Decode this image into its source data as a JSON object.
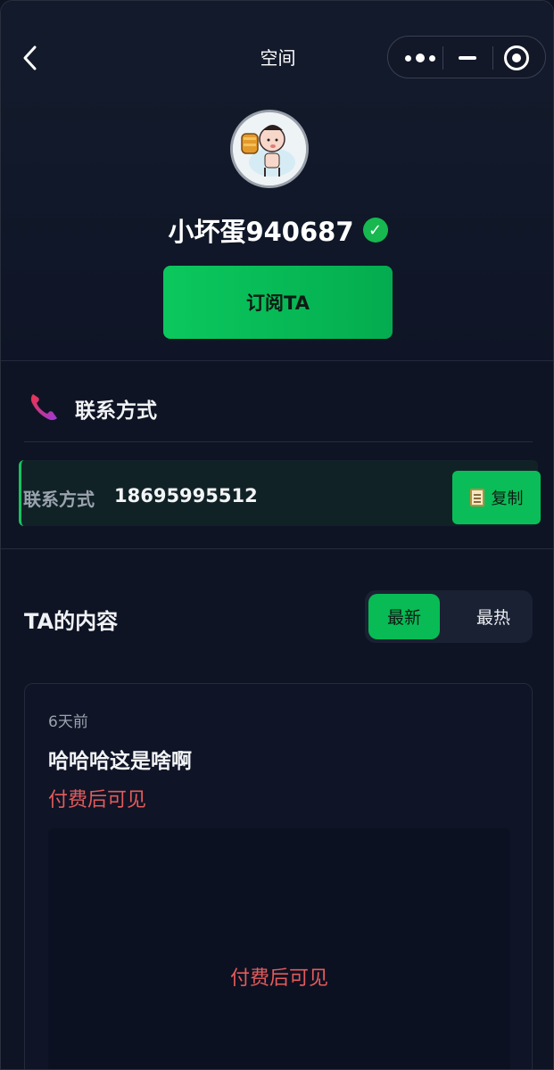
{
  "nav": {
    "title": "空间"
  },
  "profile": {
    "name": "小坏蛋940687",
    "verified_mark": "✓",
    "subscribe_label": "订阅TA"
  },
  "contact": {
    "section_title": "联系方式",
    "label": "联系方式",
    "value": "18695995512",
    "copy_label": "复制"
  },
  "content": {
    "section_title": "TA的内容",
    "tabs": [
      {
        "label": "最新",
        "active": true
      },
      {
        "label": "最热",
        "active": false
      }
    ],
    "posts": [
      {
        "time": "6天前",
        "title": "哈哈哈这是啥啊",
        "paid_text": "付费后可见",
        "locked_text": "付费后可见"
      }
    ]
  },
  "colors": {
    "accent": "#08bb55",
    "paid": "#e35b5b",
    "background": "#0f1424"
  }
}
